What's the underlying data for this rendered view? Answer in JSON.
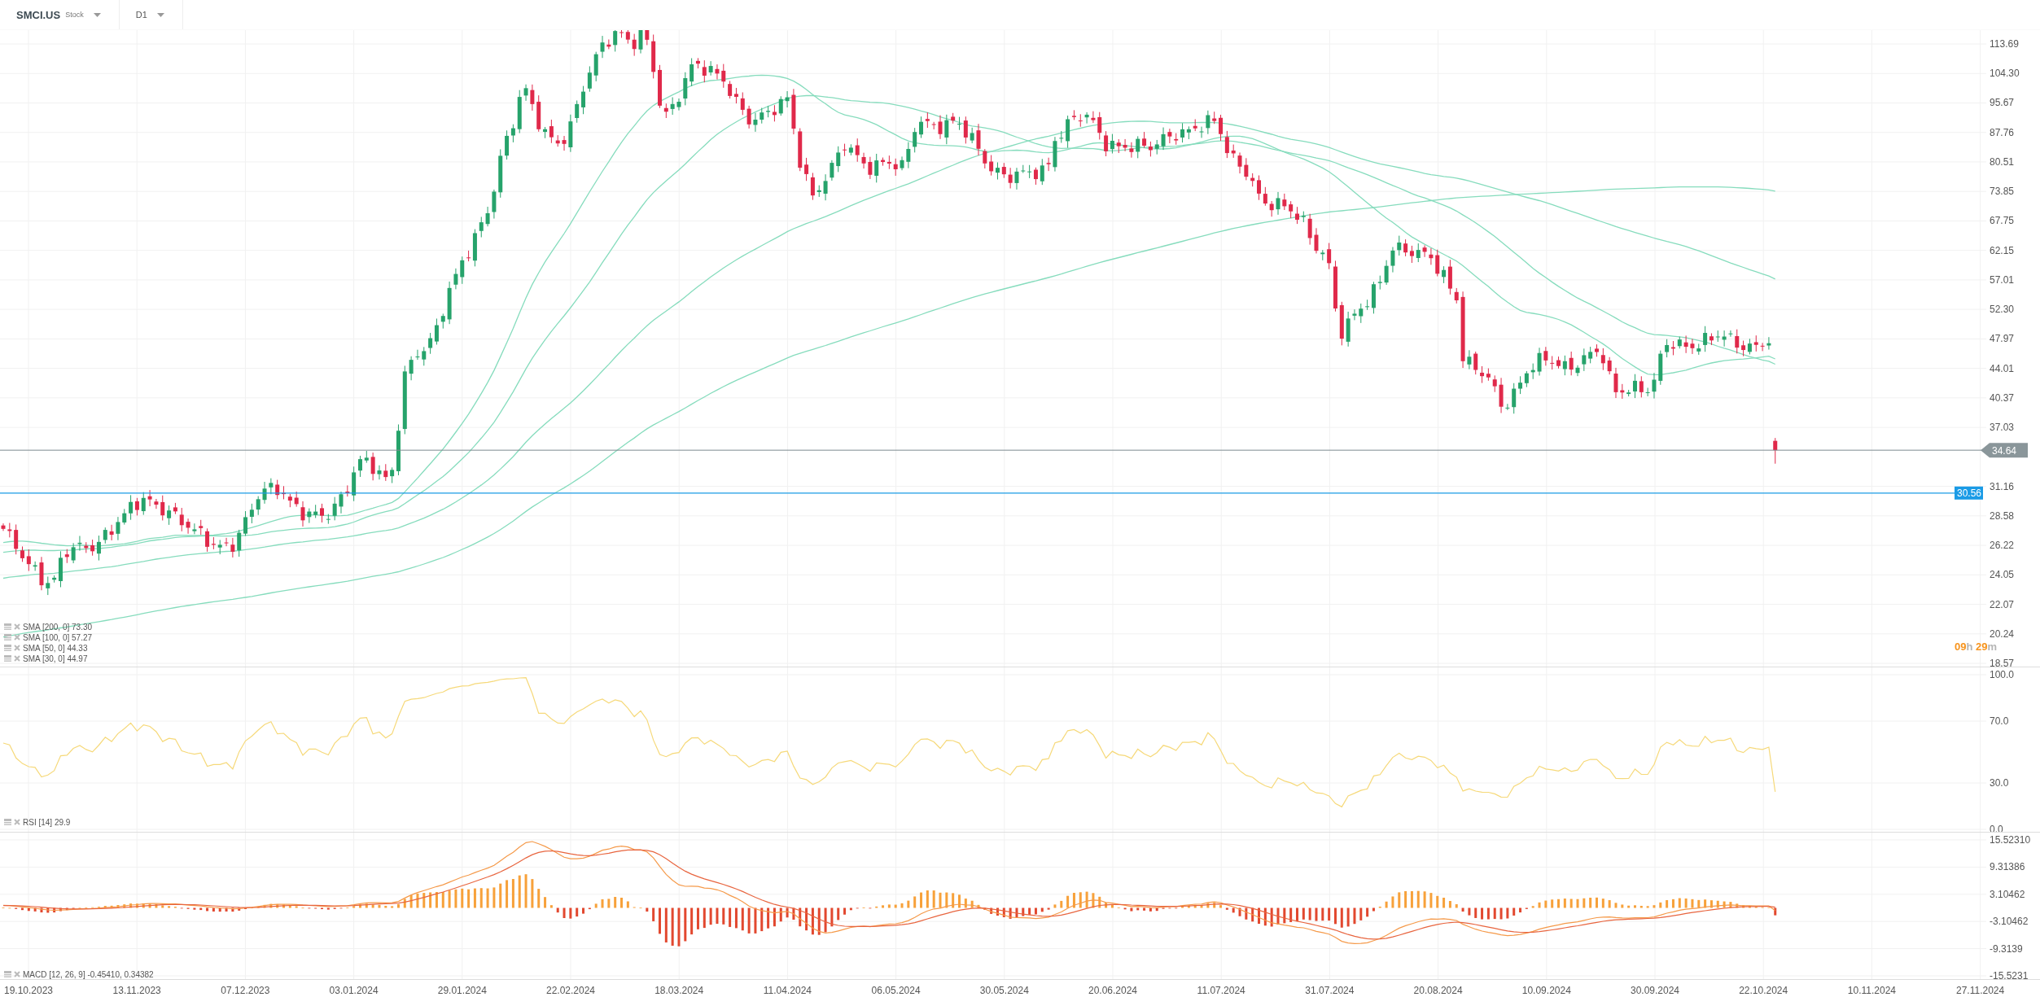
{
  "header": {
    "symbol": "SMCI.US",
    "instrument_type": "Stock",
    "timeframe": "D1"
  },
  "price_axis": [
    "113.69",
    "104.30",
    "95.67",
    "87.76",
    "80.51",
    "73.85",
    "67.75",
    "62.15",
    "57.01",
    "52.30",
    "47.97",
    "44.01",
    "40.37",
    "37.03",
    "31.16",
    "28.58",
    "26.22",
    "24.05",
    "22.07",
    "20.24",
    "18.57"
  ],
  "price_lines": [
    {
      "label": "34.64",
      "kind": "last"
    },
    {
      "label": "30.56",
      "kind": "level"
    }
  ],
  "countdown": [
    {
      "text": "09",
      "kind": "value"
    },
    {
      "text": "h",
      "kind": "unit"
    },
    {
      "text": " 29",
      "kind": "value"
    },
    {
      "text": "m",
      "kind": "unit"
    }
  ],
  "price_legend": [
    "SMA [200, 0] 73.30",
    "SMA [100, 0] 57.27",
    "SMA [50, 0] 44.33",
    "SMA [30, 0] 44.97"
  ],
  "rsi": {
    "legend": "RSI [14] 29.9",
    "axis": [
      "100.0",
      "70.0",
      "30.0",
      "0.0"
    ]
  },
  "macd": {
    "legend": "MACD [12, 26, 9] -0.45410, 0.34382",
    "axis": [
      "15.52310",
      "9.31386",
      "3.10462",
      "-3.10462",
      "-9.3139",
      "-15.5231"
    ]
  },
  "dates": [
    "19.10.2023",
    "13.11.2023",
    "07.12.2023",
    "03.01.2024",
    "29.01.2024",
    "22.02.2024",
    "18.03.2024",
    "11.04.2024",
    "06.05.2024",
    "30.05.2024",
    "20.06.2024",
    "11.07.2024",
    "31.07.2024",
    "20.08.2024",
    "10.09.2024",
    "30.09.2024",
    "22.10.2024",
    "10.11.2024",
    "27.11.2024"
  ]
}
